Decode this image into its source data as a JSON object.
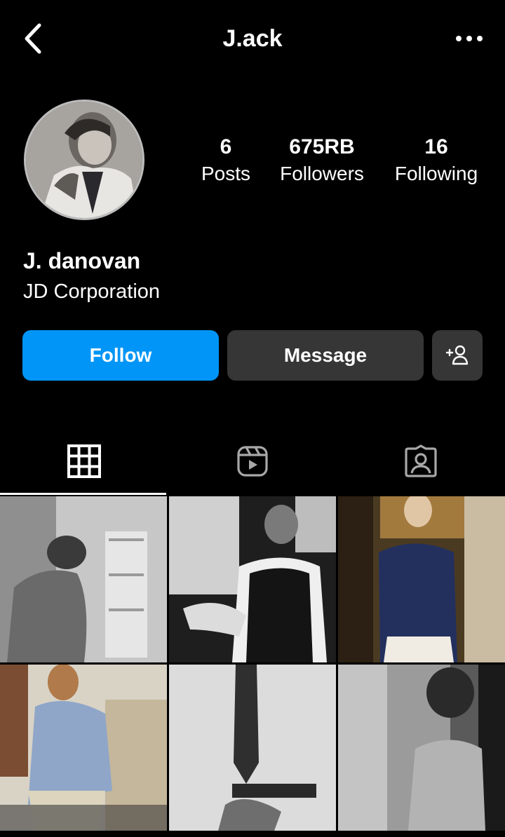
{
  "header": {
    "title": "J.ack",
    "back_icon": "chevron-left-icon",
    "more_icon": "more-horizontal-icon"
  },
  "profile": {
    "name": "J. danovan",
    "bio": "JD Corporation",
    "stats": [
      {
        "value": "6",
        "label": "Posts"
      },
      {
        "value": "675RB",
        "label": "Followers"
      },
      {
        "value": "16",
        "label": "Following"
      }
    ]
  },
  "actions": {
    "follow_label": "Follow",
    "message_label": "Message",
    "add_person_icon": "add-person-icon"
  },
  "tabs": [
    {
      "icon": "grid-icon",
      "active": true
    },
    {
      "icon": "reels-icon",
      "active": false
    },
    {
      "icon": "tagged-icon",
      "active": false
    }
  ],
  "posts": [
    {
      "tone": "grayscale"
    },
    {
      "tone": "grayscale"
    },
    {
      "tone": "color"
    },
    {
      "tone": "color"
    },
    {
      "tone": "grayscale"
    },
    {
      "tone": "grayscale"
    }
  ],
  "colors": {
    "background": "#000000",
    "accent": "#0095f6",
    "secondary_button": "#363636"
  }
}
